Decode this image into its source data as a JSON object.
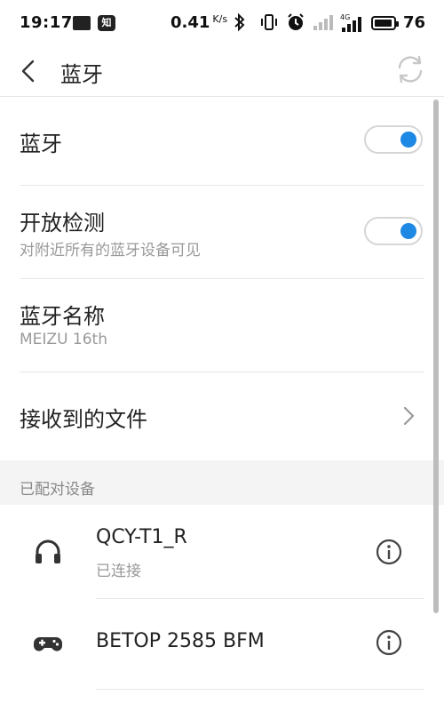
{
  "status_bar": {
    "time": "19:17",
    "notif_zhi": "知",
    "net_speed": "0.41",
    "net_unit": "K/s",
    "battery_level": "76",
    "network_label": "4G"
  },
  "header": {
    "title": "蓝牙"
  },
  "settings": {
    "bluetooth": {
      "label": "蓝牙",
      "enabled": true
    },
    "discoverable": {
      "label": "开放检测",
      "sub": "对附近所有的蓝牙设备可见",
      "enabled": true
    },
    "device_name": {
      "label": "蓝牙名称",
      "value": "MEIZU 16th"
    },
    "received_files": {
      "label": "接收到的文件"
    }
  },
  "paired": {
    "header": "已配对设备",
    "devices": [
      {
        "name": "QCY-T1_R",
        "status": "已连接",
        "icon": "headphones-icon"
      },
      {
        "name": "BETOP 2585 BFM",
        "status": "",
        "icon": "gamepad-icon"
      }
    ]
  },
  "colors": {
    "accent": "#1e88e5",
    "toggle_border": "#d6d6d6",
    "section_bg": "#f4f4f4"
  }
}
